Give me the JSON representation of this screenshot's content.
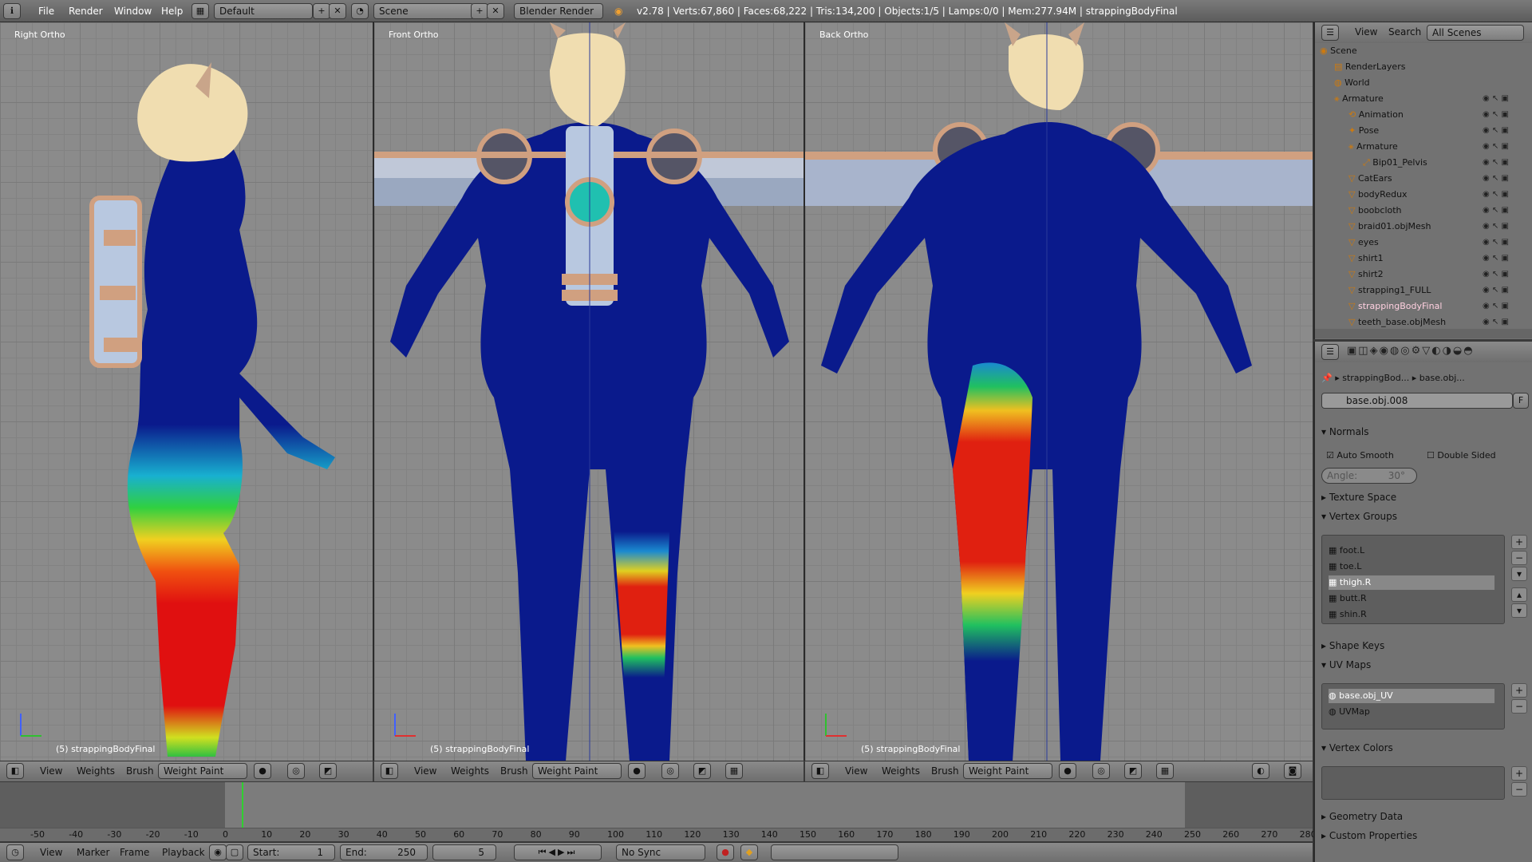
{
  "topbar": {
    "menus": [
      "File",
      "Render",
      "Window",
      "Help"
    ],
    "layout": "Default",
    "scene": "Scene",
    "engine": "Blender Render",
    "info": "v2.78 | Verts:67,860 | Faces:68,222 | Tris:134,200 | Objects:1/5 | Lamps:0/0 | Mem:277.94M | strappingBodyFinal"
  },
  "viewports": [
    {
      "title": "Right Ortho",
      "object": "(5) strappingBodyFinal"
    },
    {
      "title": "Front Ortho",
      "object": "(5) strappingBodyFinal"
    },
    {
      "title": "Back Ortho",
      "object": "(5) strappingBodyFinal"
    }
  ],
  "viewport_header": {
    "view": "View",
    "weights": "Weights",
    "brush": "Brush",
    "mode": "Weight Paint"
  },
  "timeline": {
    "ticks": [
      "-50",
      "-40",
      "-30",
      "-20",
      "-10",
      "0",
      "10",
      "20",
      "30",
      "40",
      "50",
      "60",
      "70",
      "80",
      "90",
      "100",
      "110",
      "120",
      "130",
      "140",
      "150",
      "160",
      "170",
      "180",
      "190",
      "200",
      "210",
      "220",
      "230",
      "240",
      "250",
      "260",
      "270",
      "280"
    ],
    "menus": [
      "View",
      "Marker",
      "Frame",
      "Playback"
    ],
    "start_label": "Start:",
    "start": "1",
    "end_label": "End:",
    "end": "250",
    "current": "5",
    "sync": "No Sync"
  },
  "outliner": {
    "view": "View",
    "search": "Search",
    "filter": "All Scenes",
    "items": [
      "Scene",
      "RenderLayers",
      "World",
      "Armature",
      "Animation",
      "Pose",
      "Armature",
      "Bip01_Pelvis",
      "CatEars",
      "bodyRedux",
      "boobcloth",
      "braid01.objMesh",
      "eyes",
      "shirt1",
      "shirt2",
      "strapping1_FULL",
      "strappingBodyFinal",
      "teeth_base.objMesh"
    ]
  },
  "properties": {
    "breadcrumb_obj": "strappingBod...",
    "breadcrumb_data": "base.obj...",
    "mesh_name": "base.obj.008",
    "fake_user": "F",
    "normals": "Normals",
    "auto_smooth": "Auto Smooth",
    "double_sided": "Double Sided",
    "angle": "Angle:",
    "angle_value": "30°",
    "texture_space": "Texture Space",
    "vertex_groups": "Vertex Groups",
    "groups": [
      "foot.L",
      "toe.L",
      "thigh.R",
      "butt.R",
      "shin.R"
    ],
    "shape_keys": "Shape Keys",
    "uv_maps": "UV Maps",
    "uvs": [
      "base.obj_UV",
      "UVMap"
    ],
    "vertex_colors": "Vertex Colors",
    "geometry_data": "Geometry Data",
    "custom_properties": "Custom Properties"
  }
}
